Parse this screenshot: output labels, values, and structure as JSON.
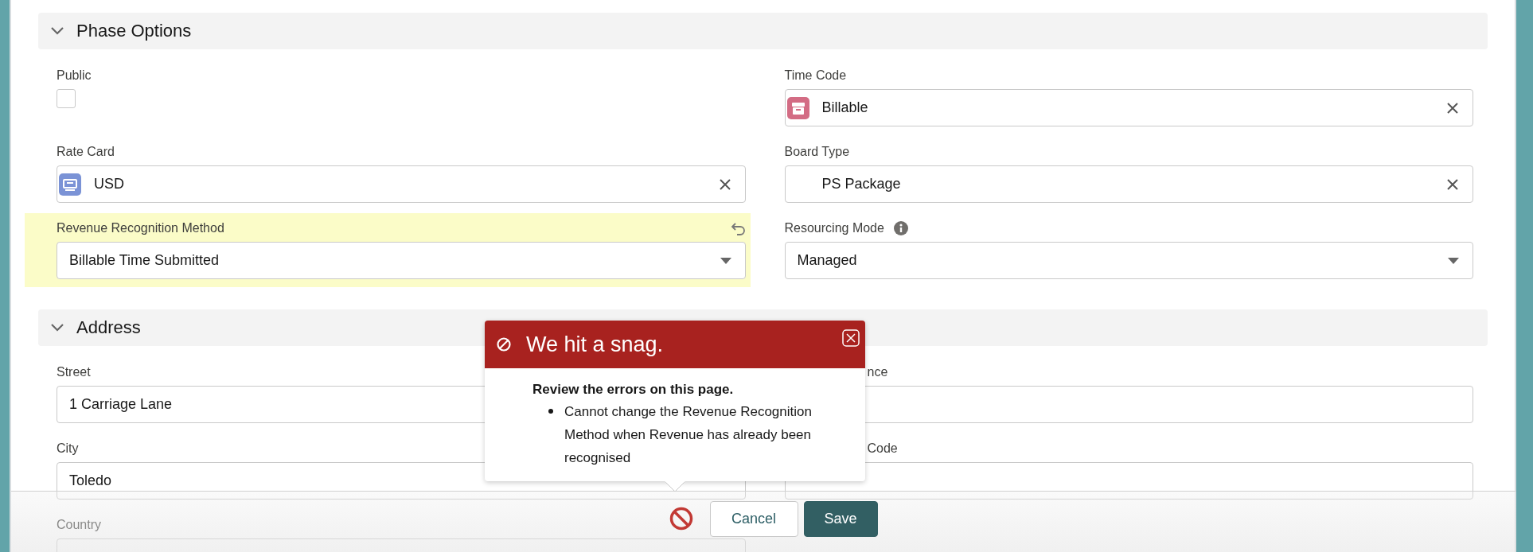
{
  "sections": [
    {
      "title": "Phase Options",
      "expanded": true,
      "left": [
        {
          "kind": "checkbox",
          "label": "Public",
          "checked": false
        },
        {
          "kind": "lookup",
          "label": "Rate Card",
          "value": "USD",
          "color": "#7b93d6"
        },
        {
          "kind": "picklist",
          "label": "Revenue Recognition Method",
          "value": "Billable Time Submitted",
          "changed": true
        }
      ],
      "right": [
        {
          "kind": "lookup",
          "label": "Time Code",
          "value": "Billable",
          "color": "#d36c84"
        },
        {
          "kind": "lookup",
          "label": "Board Type",
          "value": "PS Package"
        },
        {
          "kind": "picklist",
          "label": "Resourcing Mode",
          "value": "Managed",
          "help": true
        }
      ]
    },
    {
      "title": "Address",
      "expanded": true,
      "left": [
        {
          "kind": "text",
          "label": "Street",
          "value": "1 Carriage Lane"
        },
        {
          "kind": "text",
          "label": "City",
          "value": "Toledo"
        },
        {
          "kind": "text",
          "label": "Country"
        }
      ],
      "right": [
        {
          "kind": "text",
          "label": "nce",
          "partly_covered": true
        },
        {
          "kind": "text",
          "label": "Code",
          "partly_covered": true
        }
      ]
    }
  ],
  "error_popup": {
    "title": "We hit a snag.",
    "heading": "Review the errors on this page.",
    "errors": [
      "Cannot change the Revenue Recognition Method when Revenue has already been recognised"
    ]
  },
  "footer": {
    "buttons": [
      {
        "label": "Cancel",
        "kind": "neutral"
      },
      {
        "label": "Save",
        "kind": "brand"
      }
    ],
    "has_errors": true
  }
}
